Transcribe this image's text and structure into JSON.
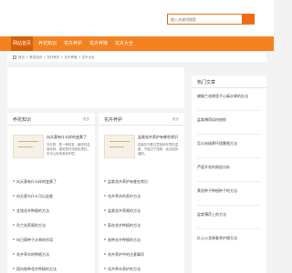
{
  "search": {
    "placeholder": "输入关键词搜索"
  },
  "nav": {
    "items": [
      "网站首页",
      "养花知识",
      "花卉养护",
      "花卉养殖",
      "花卉大全"
    ]
  },
  "breadcrumb": {
    "text": "首页 > 养花知识 > 花卉养护 > 花卉养殖 > 花卉大全"
  },
  "sidebar": {
    "title": "热门文章",
    "items": [
      "蝴蝶兰花期里子心痛水果的办法",
      "盆栽薄荷如何修剪",
      "怎么给绿萝扦插繁殖方法",
      "芦荟开花的原因分析",
      "黄花种子种植种子的方法",
      "盆栽薄荷上的方法",
      "红心火龙果春季护理方法"
    ]
  },
  "knowledge": {
    "title": "养花知识",
    "more": "更多",
    "feature": {
      "title": "向天葵有什么样的变黄了",
      "desc": "向天葵，是一种较常，最好的盆栽花种。通常是开花颜色漂亮，也可以用来美化环境。"
    },
    "items": [
      "向天葵有什么样的变黄了",
      "向天葵为什么可以盆栽",
      "金钱花卉种植的方法",
      "吊兰花养殖的方法",
      "向日葵种子水果的作用",
      "花卉草木的种植方法",
      "国内各种花卉种植的方法"
    ]
  },
  "care": {
    "title": "花卉养护",
    "more": "更多",
    "feature": {
      "title": "盆栽花卉养护有哪些常识",
      "desc": "盆栽花卉要注意各种环境的温度，不能过于湿润，适当保持通风。"
    },
    "items": [
      "盆栽花卉养护有哪些常识",
      "花卉草木的养护方法",
      "盆栽花卉养殖的方法",
      "菊花花卉种植的方法",
      "各种花卉种植的方法",
      "花卉养护中的注意事项",
      "花卉草木养护的方法"
    ]
  },
  "colors": {
    "brand": "#f58220",
    "nav_active": "#d95f06"
  }
}
